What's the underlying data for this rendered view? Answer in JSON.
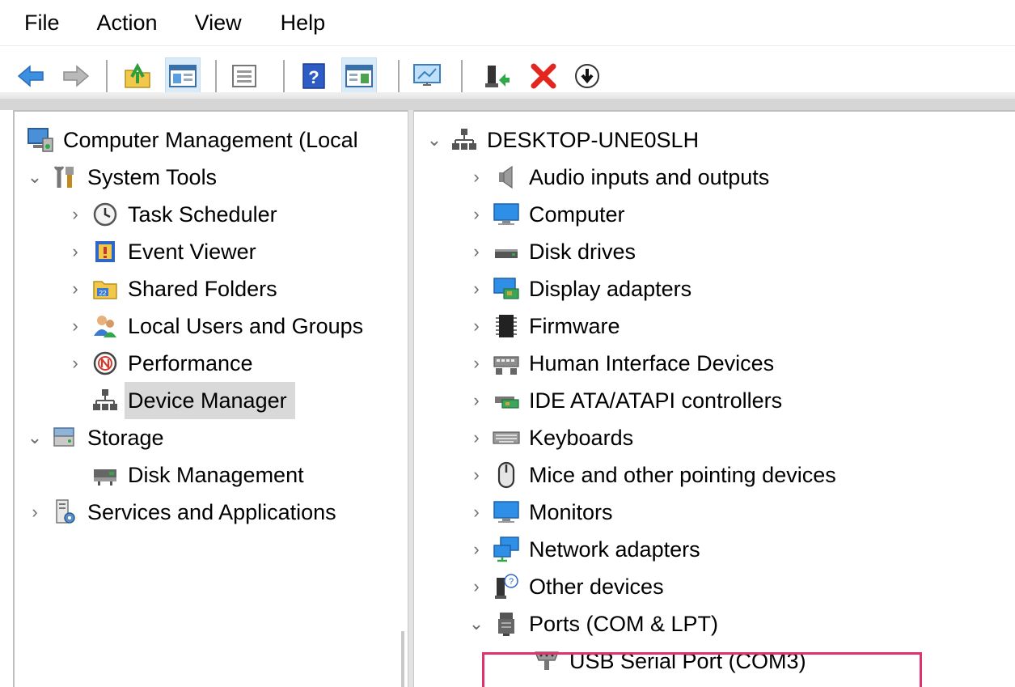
{
  "menu": [
    "File",
    "Action",
    "View",
    "Help"
  ],
  "toolbar": {
    "buttons": [
      {
        "name": "back-icon"
      },
      {
        "name": "forward-icon"
      },
      {
        "name": "up-folder-icon"
      },
      {
        "name": "show-hide-console-tree-icon",
        "pressed": true
      },
      {
        "name": "properties-icon"
      },
      {
        "name": "help-icon"
      },
      {
        "name": "show-hide-action-pane-icon",
        "pressed": true
      },
      {
        "name": "scan-hardware-icon"
      },
      {
        "name": "update-driver-icon"
      },
      {
        "name": "uninstall-icon"
      },
      {
        "name": "disable-device-icon"
      }
    ]
  },
  "left_tree": [
    {
      "label": "Computer Management (Local",
      "icon": "computer-management-icon",
      "chevron": ""
    },
    {
      "label": "System Tools",
      "icon": "system-tools-icon",
      "chevron": "expanded"
    },
    {
      "label": "Task Scheduler",
      "icon": "clock-icon",
      "chevron": "collapsed"
    },
    {
      "label": "Event Viewer",
      "icon": "event-viewer-icon",
      "chevron": "collapsed"
    },
    {
      "label": "Shared Folders",
      "icon": "shared-folders-icon",
      "chevron": "collapsed"
    },
    {
      "label": "Local Users and Groups",
      "icon": "users-icon",
      "chevron": "collapsed"
    },
    {
      "label": "Performance",
      "icon": "performance-icon",
      "chevron": "collapsed"
    },
    {
      "label": "Device Manager",
      "icon": "device-manager-icon",
      "chevron": "",
      "selected": true
    },
    {
      "label": "Storage",
      "icon": "storage-icon",
      "chevron": "expanded"
    },
    {
      "label": "Disk Management",
      "icon": "disk-management-icon",
      "chevron": ""
    },
    {
      "label": "Services and Applications",
      "icon": "services-icon",
      "chevron": "collapsed"
    }
  ],
  "right_tree": [
    {
      "label": "DESKTOP-UNE0SLH",
      "icon": "computer-node-icon",
      "chevron": "expanded"
    },
    {
      "label": "Audio inputs and outputs",
      "icon": "speaker-icon",
      "chevron": "collapsed"
    },
    {
      "label": "Computer",
      "icon": "monitor-icon",
      "chevron": "collapsed"
    },
    {
      "label": "Disk drives",
      "icon": "disk-drive-icon",
      "chevron": "collapsed"
    },
    {
      "label": "Display adapters",
      "icon": "display-adapter-icon",
      "chevron": "collapsed"
    },
    {
      "label": "Firmware",
      "icon": "chip-icon",
      "chevron": "collapsed"
    },
    {
      "label": "Human Interface Devices",
      "icon": "hid-icon",
      "chevron": "collapsed"
    },
    {
      "label": "IDE ATA/ATAPI controllers",
      "icon": "ide-controller-icon",
      "chevron": "collapsed"
    },
    {
      "label": "Keyboards",
      "icon": "keyboard-icon",
      "chevron": "collapsed"
    },
    {
      "label": "Mice and other pointing devices",
      "icon": "mouse-icon",
      "chevron": "collapsed"
    },
    {
      "label": "Monitors",
      "icon": "monitor-icon",
      "chevron": "collapsed"
    },
    {
      "label": "Network adapters",
      "icon": "network-adapter-icon",
      "chevron": "collapsed"
    },
    {
      "label": "Other devices",
      "icon": "unknown-device-icon",
      "chevron": "collapsed"
    },
    {
      "label": "Ports (COM & LPT)",
      "icon": "port-icon",
      "chevron": "expanded"
    },
    {
      "label": "USB Serial Port (COM3)",
      "icon": "serial-connector-icon",
      "chevron": "",
      "highlighted": true
    }
  ],
  "colors": {
    "highlight_border": "#e0326e",
    "selection": "#d9d9d9",
    "pressed_button": "#d9ebf9"
  }
}
